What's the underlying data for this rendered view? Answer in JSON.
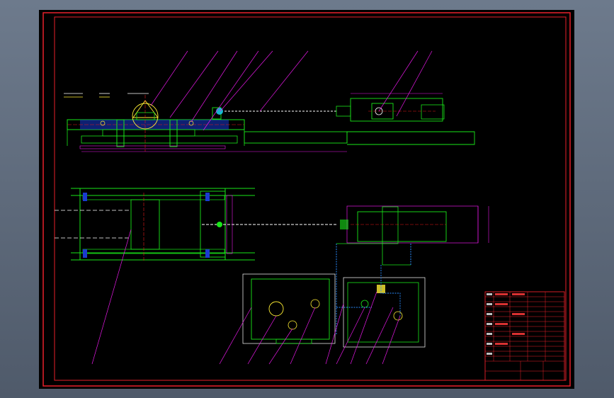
{
  "drawing": {
    "title_block": {
      "rows": 14,
      "columns": 5
    }
  },
  "colors": {
    "frame": "#e8202a",
    "geometry": "#19e619",
    "leader": "#e619e6",
    "centerline": "#e61919",
    "hidden": "#ffffff",
    "highlight": "#ffee33",
    "piping": "#2a8cff",
    "accent": "#19c8e6",
    "background": "#000000"
  }
}
